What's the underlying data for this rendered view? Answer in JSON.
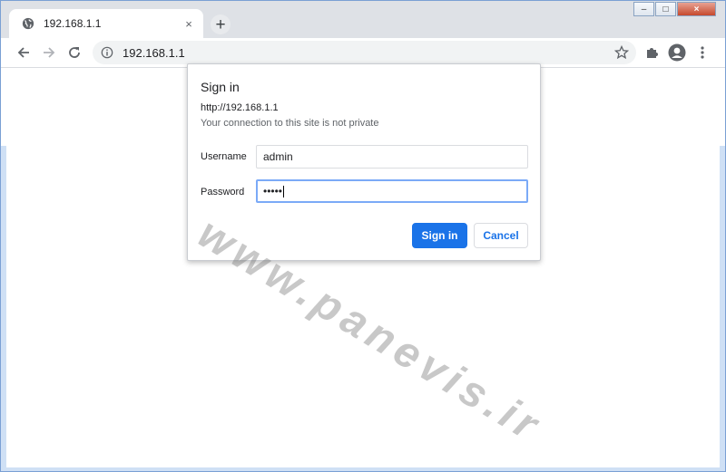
{
  "tab": {
    "title": "192.168.1.1",
    "close_glyph": "×",
    "favicon": "globe-icon"
  },
  "newtab_glyph": "+",
  "window_controls": {
    "minimize": "–",
    "maximize": "□",
    "close": "×"
  },
  "omnibox": {
    "url": "192.168.1.1"
  },
  "dialog": {
    "title": "Sign in",
    "origin": "http://192.168.1.1",
    "note": "Your connection to this site is not private",
    "username_label": "Username",
    "username_value": "admin",
    "password_label": "Password",
    "password_value": "•••••",
    "signin_label": "Sign in",
    "cancel_label": "Cancel"
  },
  "watermark": "www.panevis.ir",
  "colors": {
    "accent": "#1a73e8",
    "focus": "#7baaf7",
    "window_frame": "#cfe0f5"
  }
}
